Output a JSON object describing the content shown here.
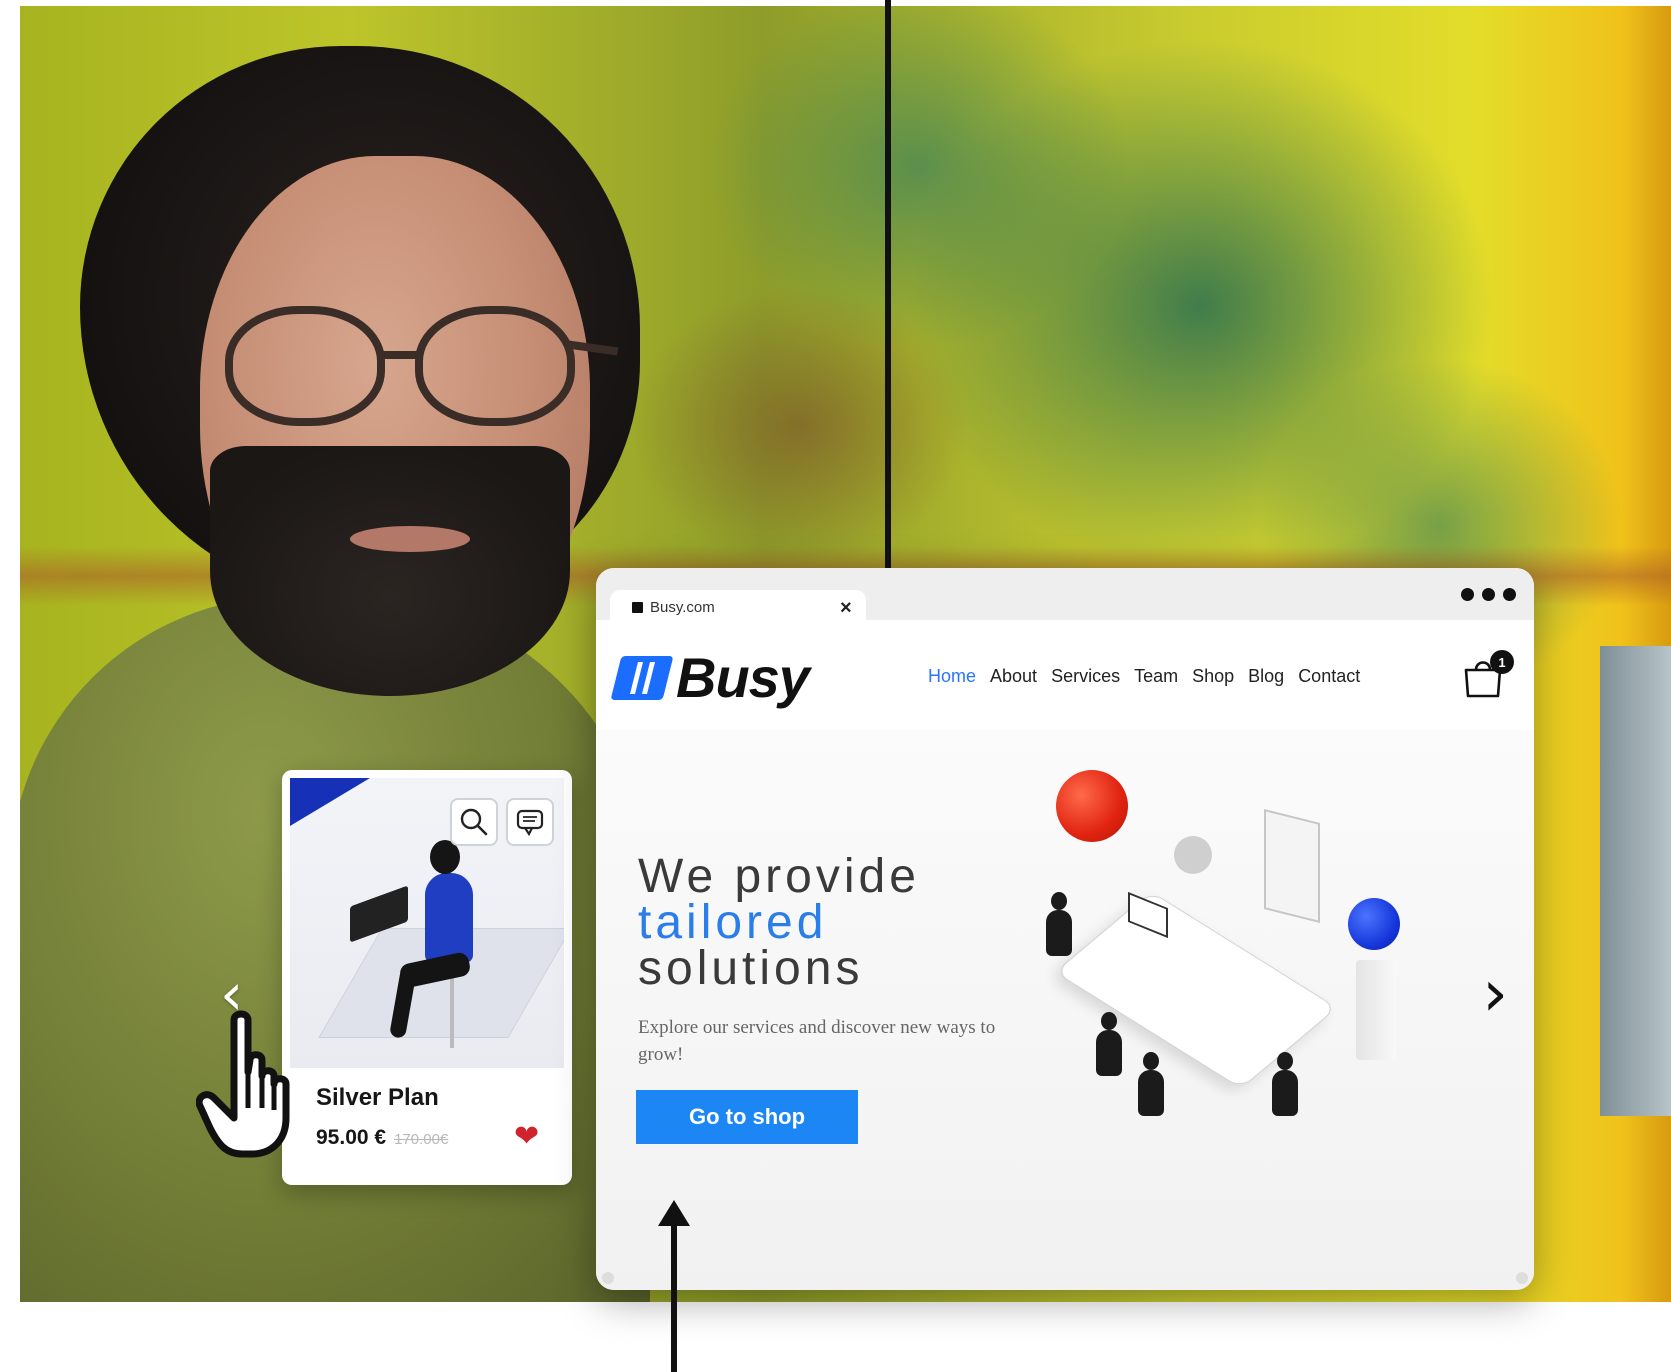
{
  "browser": {
    "tab_title": "Busy.com",
    "tab_close": "×"
  },
  "site": {
    "logo_text": "Busy",
    "nav": [
      "Home",
      "About",
      "Services",
      "Team",
      "Shop",
      "Blog",
      "Contact"
    ],
    "nav_active": "Home",
    "cart_count": "1"
  },
  "hero": {
    "title_line1": "We provide",
    "title_line2": "tailored",
    "title_line3": "solutions",
    "subtitle": "Explore our services and discover new ways to grow!",
    "cta_label": "Go to shop",
    "next_icon": "chevron-right-icon"
  },
  "product_card": {
    "title": "Silver Plan",
    "price": "95.00 €",
    "old_price": "170.00€",
    "search_icon": "search-icon",
    "chat_icon": "chat-icon",
    "favorite_icon": "heart-icon",
    "prev_icon": "chevron-left-icon"
  },
  "colors": {
    "accent_blue": "#1d86f5",
    "nav_active": "#2b74ff",
    "heart_red": "#d1232c",
    "logo_blue": "#1a6dff"
  }
}
